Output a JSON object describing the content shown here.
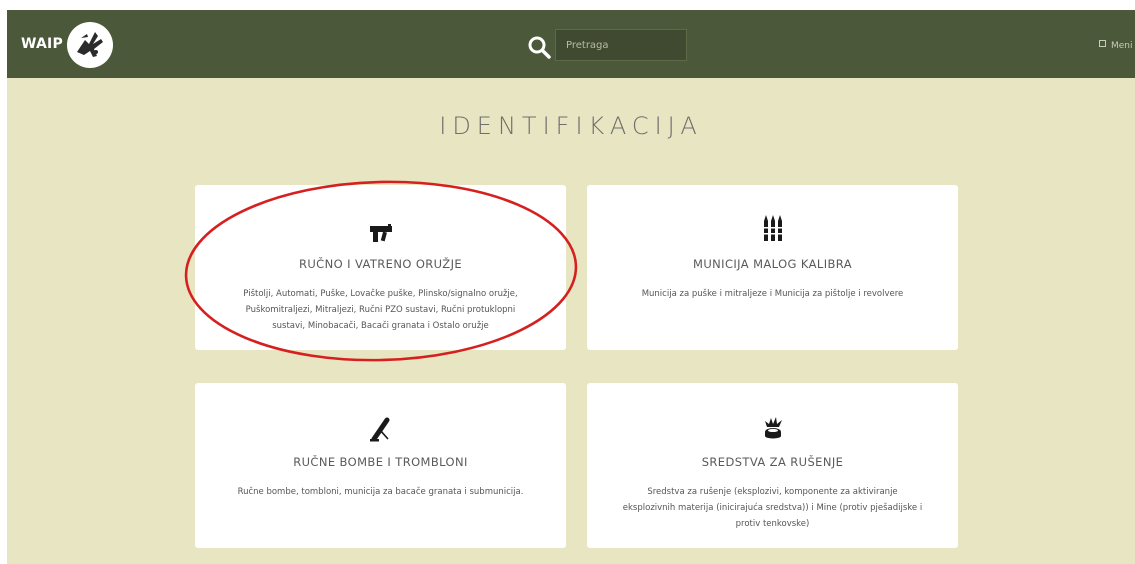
{
  "header": {
    "brand": "WAIP",
    "logo_icon": "waip-logo-icon",
    "search_icon": "search-icon",
    "search_placeholder": "Pretraga",
    "menu_label": "Meni"
  },
  "page": {
    "title": "IDENTIFIKACIJA"
  },
  "categories": [
    {
      "icon": "submachine-gun-icon",
      "title": "RUČNO I VATRENO ORUŽJE",
      "description_lines": [
        "Pištolji, Automati, Puške, Lovačke puške, Plinsko/signalno oružje,",
        "Puškomitraljezi, Mitraljezi, Ručni PZO sustavi, Ručni protuklopni",
        "sustavi, Minobacači, Bacači granata i Ostalo oružje"
      ],
      "highlighted": true
    },
    {
      "icon": "ammunition-icon",
      "title": "MUNICIJA MALOG KALIBRA",
      "description_lines": [
        "Municija za puške i mitraljeze i Municija za pištolje i revolvere"
      ],
      "highlighted": false
    },
    {
      "icon": "mortar-icon",
      "title": "RUČNE BOMBE I TROMBLONI",
      "description_lines": [
        "Ručne bombe, tombloni, municija za bacače granata i submunicija."
      ],
      "highlighted": false
    },
    {
      "icon": "explosion-icon",
      "title": "SREDSTVA ZA RUŠENJE",
      "description_lines": [
        "Sredstva za rušenje (eksplozivi, komponente za aktiviranje",
        "eksplozivnih materija (inicirajuća sredstva)) i Mine (protiv pješadijske i",
        "protiv tenkovske)"
      ],
      "highlighted": false
    }
  ],
  "colors": {
    "navbar": "#4b5839",
    "background": "#e8e6c2",
    "card": "#ffffff",
    "highlight": "#d62020"
  }
}
